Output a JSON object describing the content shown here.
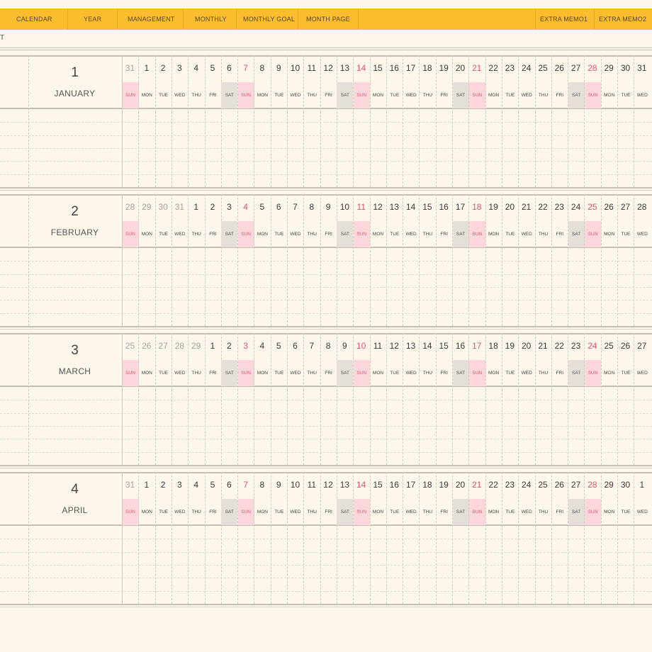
{
  "nav": {
    "items": [
      "CALENDAR",
      "YEAR",
      "MANAGEMENT",
      "MONTHLY",
      "MONTHLY GOAL",
      "MONTH PAGE",
      "EXTRA MEMO1",
      "EXTRA MEMO2"
    ]
  },
  "corner_mark": "T",
  "dow_labels": [
    "SUN",
    "MON",
    "TUE",
    "WED",
    "THU",
    "FRI",
    "SAT"
  ],
  "months": [
    {
      "number": "1",
      "name": "JANUARY",
      "dates": [
        "31",
        "1",
        "2",
        "3",
        "4",
        "5",
        "6",
        "7",
        "8",
        "9",
        "10",
        "11",
        "12",
        "13",
        "14",
        "15",
        "16",
        "17",
        "18",
        "19",
        "20",
        "21",
        "22",
        "23",
        "24",
        "25",
        "26",
        "27",
        "28",
        "29",
        "30",
        "31"
      ],
      "prev_count": 1
    },
    {
      "number": "2",
      "name": "FEBRUARY",
      "dates": [
        "28",
        "29",
        "30",
        "31",
        "1",
        "2",
        "3",
        "4",
        "5",
        "6",
        "7",
        "8",
        "9",
        "10",
        "11",
        "12",
        "13",
        "14",
        "15",
        "16",
        "17",
        "18",
        "19",
        "20",
        "21",
        "22",
        "23",
        "24",
        "25",
        "26",
        "27",
        "28"
      ],
      "prev_count": 4
    },
    {
      "number": "3",
      "name": "MARCH",
      "dates": [
        "25",
        "26",
        "27",
        "28",
        "29",
        "1",
        "2",
        "3",
        "4",
        "5",
        "6",
        "7",
        "8",
        "9",
        "10",
        "11",
        "12",
        "13",
        "14",
        "15",
        "16",
        "17",
        "18",
        "19",
        "20",
        "21",
        "22",
        "23",
        "24",
        "25",
        "26",
        "27"
      ],
      "prev_count": 5
    },
    {
      "number": "4",
      "name": "APRIL",
      "dates": [
        "31",
        "1",
        "2",
        "3",
        "4",
        "5",
        "6",
        "7",
        "8",
        "9",
        "10",
        "11",
        "12",
        "13",
        "14",
        "15",
        "16",
        "17",
        "18",
        "19",
        "20",
        "21",
        "22",
        "23",
        "24",
        "25",
        "26",
        "27",
        "28",
        "29",
        "30",
        "1"
      ],
      "prev_count": 1
    }
  ],
  "colors": {
    "nav_bg": "#fbbd2e",
    "page_bg": "#fdf6ea",
    "sunday": "#e0566c",
    "sunday_bg": "#fbd6dc",
    "saturday_bg": "#e4e0d9"
  }
}
